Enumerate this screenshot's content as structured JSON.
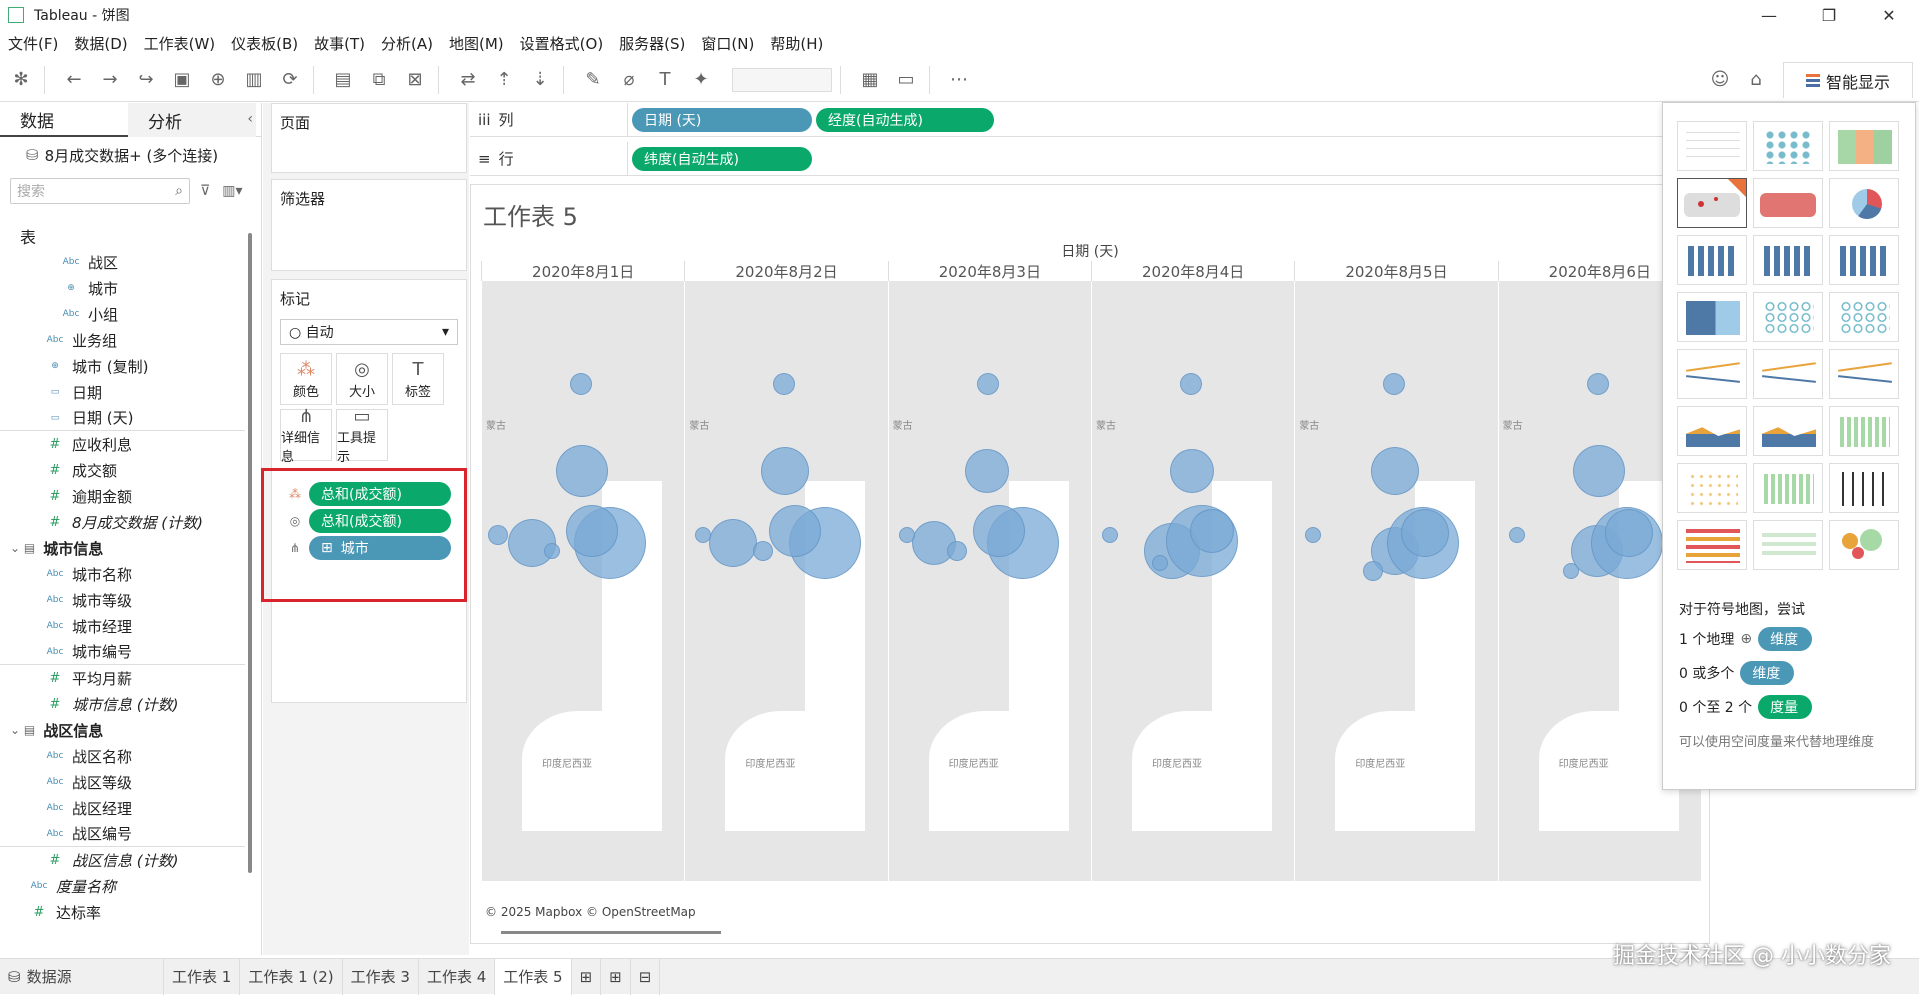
{
  "window": {
    "title": "Tableau - 饼图"
  },
  "menu": [
    "文件(F)",
    "数据(D)",
    "工作表(W)",
    "仪表板(B)",
    "故事(T)",
    "分析(A)",
    "地图(M)",
    "设置格式(O)",
    "服务器(S)",
    "窗口(N)",
    "帮助(H)"
  ],
  "toolbar": {
    "smart_label": "智能显示"
  },
  "datapane": {
    "tab_data": "数据",
    "tab_analysis": "分析",
    "connection": "8月成交数据+ (多个连接)",
    "search_placeholder": "搜索",
    "fields": [
      {
        "type": "section",
        "label": "表"
      },
      {
        "type": "dim",
        "label": "战区",
        "indent": 2
      },
      {
        "type": "geo",
        "label": "城市",
        "indent": 2
      },
      {
        "type": "dim",
        "label": "小组",
        "indent": 2
      },
      {
        "type": "dim",
        "label": "业务组",
        "indent": 1
      },
      {
        "type": "geo",
        "label": "城市 (复制)",
        "indent": 1
      },
      {
        "type": "date",
        "label": "日期",
        "indent": 1
      },
      {
        "type": "date",
        "label": "日期 (天)",
        "indent": 1,
        "sep": true
      },
      {
        "type": "num",
        "label": "应收利息",
        "indent": 1
      },
      {
        "type": "num",
        "label": "成交额",
        "indent": 1
      },
      {
        "type": "num",
        "label": "逾期金额",
        "indent": 1
      },
      {
        "type": "num",
        "label": "8月成交数据 (计数)",
        "indent": 1,
        "italic": true
      },
      {
        "type": "group",
        "label": "城市信息"
      },
      {
        "type": "dim",
        "label": "城市名称",
        "indent": 1
      },
      {
        "type": "dim",
        "label": "城市等级",
        "indent": 1
      },
      {
        "type": "dim",
        "label": "城市经理",
        "indent": 1
      },
      {
        "type": "dim",
        "label": "城市编号",
        "indent": 1,
        "sep": true
      },
      {
        "type": "num",
        "label": "平均月薪",
        "indent": 1
      },
      {
        "type": "num",
        "label": "城市信息 (计数)",
        "indent": 1,
        "italic": true
      },
      {
        "type": "group",
        "label": "战区信息"
      },
      {
        "type": "dim",
        "label": "战区名称",
        "indent": 1
      },
      {
        "type": "dim",
        "label": "战区等级",
        "indent": 1
      },
      {
        "type": "dim",
        "label": "战区经理",
        "indent": 1
      },
      {
        "type": "dim",
        "label": "战区编号",
        "indent": 1,
        "sep": true
      },
      {
        "type": "num",
        "label": "战区信息 (计数)",
        "indent": 1,
        "italic": true
      },
      {
        "type": "dim",
        "label": "度量名称",
        "indent": 0,
        "italic": true
      },
      {
        "type": "num",
        "label": "达标率",
        "indent": 0
      }
    ]
  },
  "cards": {
    "pages": "页面",
    "filters": "筛选器",
    "marks": "标记",
    "mark_type": "自动",
    "buttons": [
      "颜色",
      "大小",
      "标签",
      "详细信息",
      "工具提示"
    ],
    "mark_pills": [
      "总和(成交额)",
      "总和(成交额)",
      "城市"
    ]
  },
  "shelves": {
    "columns_label": "列",
    "rows_label": "行",
    "columns_pills": [
      "日期 (天)",
      "经度(自动生成)"
    ],
    "rows_pills": [
      "纬度(自动生成)"
    ]
  },
  "viz": {
    "title": "工作表 5",
    "header": "日期 (天)",
    "panels": [
      "2020年8月1日",
      "2020年8月2日",
      "2020年8月3日",
      "2020年8月4日",
      "2020年8月5日",
      "2020年8月6日"
    ],
    "map_label_mongolia": "蒙古",
    "map_label_indonesia": "印度尼西亚",
    "copyright": "© 2025 Mapbox © OpenStreetMap",
    "bubble_color": "#7aaad6"
  },
  "smart_panel": {
    "hint_title": "对于符号地图，尝试",
    "hints": [
      {
        "prefix": "1 个地理",
        "pill": "维度",
        "color": "blue"
      },
      {
        "prefix": "0 或多个",
        "pill": "维度",
        "color": "blue"
      },
      {
        "prefix": "0 个至 2 个",
        "pill": "度量",
        "color": "green"
      }
    ],
    "note": "可以使用空间度量来代替地理维度"
  },
  "bottom": {
    "datasource": "数据源",
    "sheets": [
      "工作表 1",
      "工作表 1 (2)",
      "工作表 3",
      "工作表 4",
      "工作表 5"
    ],
    "active_index": 4
  },
  "watermark": "掘金技术社区 @ 小小数分家",
  "colors": {
    "green_pill": "#0aa86b",
    "blue_pill": "#4a98b6",
    "highlight": "#d9232d"
  }
}
